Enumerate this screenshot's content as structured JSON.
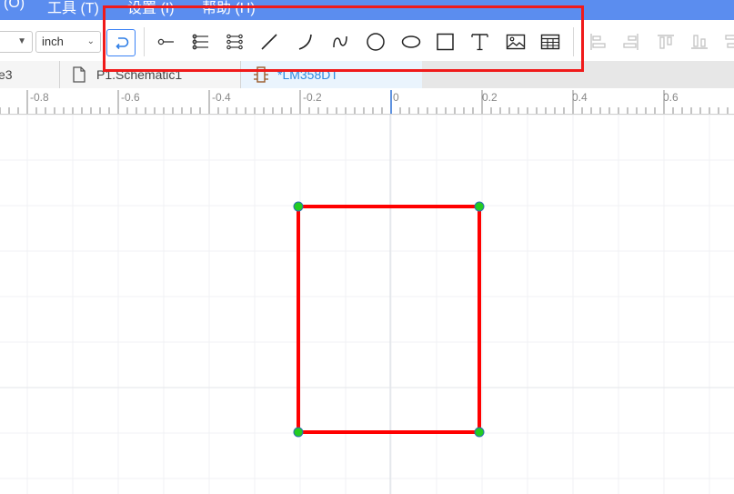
{
  "menu": {
    "item_format": "(O)",
    "item_tools": "工具 (T)",
    "item_settings": "设置 (I)",
    "item_help": "帮助 (H)"
  },
  "toolbar": {
    "unit_select": "inch",
    "tools": [
      "pin",
      "pin-array",
      "pin-double-array",
      "line",
      "arc",
      "bezier",
      "circle",
      "ellipse",
      "rectangle",
      "text",
      "image",
      "table"
    ],
    "align_tools": [
      "align-left",
      "align-right",
      "align-top",
      "align-bottom",
      "align-center"
    ]
  },
  "tabs": [
    {
      "label": "e3"
    },
    {
      "label": "P1.Schematic1"
    },
    {
      "label": "*LM358DT"
    }
  ],
  "ruler": {
    "labels": [
      "-0.8",
      "-0.6",
      "-0.4",
      "-0.2",
      "0",
      "0.2",
      "0.4",
      "0.6"
    ]
  },
  "canvas": {
    "shape": "rectangle",
    "stroke_color": "#ff0000",
    "handle_color": "#22cc22"
  },
  "colors": {
    "accent": "#5b8def",
    "highlight": "#f01a1a",
    "active_tab_text": "#2f8ae0"
  }
}
